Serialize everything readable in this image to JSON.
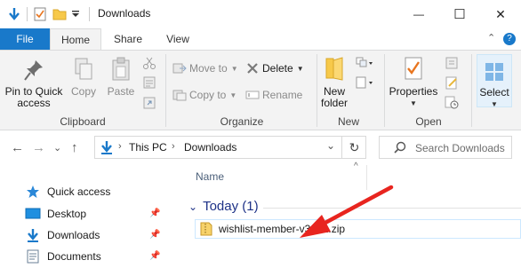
{
  "window": {
    "title": "Downloads",
    "minimize_glyph": "—",
    "maximize_glyph": "☐",
    "close_glyph": "✕"
  },
  "ribbon_tabs": {
    "file": "File",
    "home": "Home",
    "share": "Share",
    "view": "View",
    "collapse_glyph": "⌃",
    "help_glyph": "?"
  },
  "clipboard": {
    "pin_label_1": "Pin to Quick",
    "pin_label_2": "access",
    "copy_label": "Copy",
    "paste_label": "Paste",
    "group_label": "Clipboard"
  },
  "organize": {
    "move_to": "Move to",
    "copy_to": "Copy to",
    "delete": "Delete",
    "rename": "Rename",
    "group_label": "Organize"
  },
  "new": {
    "new_folder_1": "New",
    "new_folder_2": "folder",
    "group_label": "New"
  },
  "open": {
    "properties": "Properties",
    "group_label": "Open"
  },
  "select": {
    "label": "Select"
  },
  "address": {
    "segments": [
      "This PC",
      "Downloads"
    ],
    "chevron": "›",
    "dropdown_glyph": "⌄",
    "refresh_glyph": "↻"
  },
  "search": {
    "placeholder": "Search Downloads"
  },
  "nav": {
    "back_glyph": "←",
    "forward_glyph": "→",
    "recent_glyph": "⌄",
    "up_glyph": "↑",
    "items": [
      {
        "label": "Quick access",
        "pinned": false
      },
      {
        "label": "Desktop",
        "pinned": true
      },
      {
        "label": "Downloads",
        "pinned": true
      },
      {
        "label": "Documents",
        "pinned": true
      }
    ]
  },
  "content": {
    "column_name": "Name",
    "sort_glyph": "^",
    "group_header": "Today (1)",
    "group_toggle_glyph": "⌄",
    "file_name": "wishlist-member-v3.5.1.zip"
  },
  "colors": {
    "file_tab": "#1979ca",
    "accent_blue": "#1e3287",
    "arrow_red": "#e8251f",
    "folder_yellow": "#f7c94a"
  }
}
